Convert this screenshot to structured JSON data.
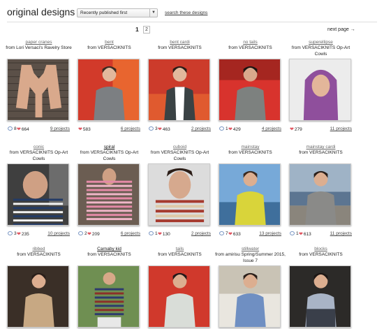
{
  "header": {
    "title": "original designs",
    "sort_value": "Recently published first",
    "search_link": "search these designs"
  },
  "pagination": {
    "current": "1",
    "next_number": "2",
    "next_label": "next page →"
  },
  "patterns": [
    {
      "name": "paper cranes",
      "from": "from Lori Versaci's Ravelry Store",
      "comments": "8",
      "favorites": "664",
      "projects": "9 projects",
      "scene": "cardigan-door"
    },
    {
      "name": "bent",
      "from": "from VERSACIKNITS",
      "comments": "",
      "favorites": "583",
      "projects": "6 projects",
      "scene": "grey-red"
    },
    {
      "name": "bent cardi",
      "from": "from VERSACIKNITS",
      "comments": "3",
      "favorites": "463",
      "projects": "2 projects",
      "scene": "cardi-red"
    },
    {
      "name": "no tails",
      "from": "from VERSACIKNITS",
      "comments": "1",
      "favorites": "429",
      "projects": "4 projects",
      "scene": "sweater-red"
    },
    {
      "name": "superellipse",
      "from": "from VERSACIKNITS Op-Art Cowls",
      "comments": "",
      "favorites": "279",
      "projects": "11 projects",
      "scene": "purple-hood"
    },
    {
      "name": "conic",
      "from": "from VERSACIKNITS Op-Art Cowls",
      "comments": "3",
      "favorites": "235",
      "projects": "10 projects",
      "scene": "navy-cowl"
    },
    {
      "name": "spiral",
      "from": "from VERSACIKNITS Op-Art Cowls",
      "comments": "2",
      "favorites": "209",
      "projects": "6 projects",
      "scene": "pink-cowl"
    },
    {
      "name": "cuboid",
      "from": "from VERSACIKNITS Op-Art Cowls",
      "comments": "1",
      "favorites": "130",
      "projects": "2 projects",
      "scene": "red-cowl"
    },
    {
      "name": "mainstay",
      "from": "from VERSACIKNITS",
      "comments": "7",
      "favorites": "633",
      "projects": "13 projects",
      "scene": "yellow-sea"
    },
    {
      "name": "mainstay cardi",
      "from": "from VERSACIKNITS",
      "comments": "1",
      "favorites": "613",
      "projects": "11 projects",
      "scene": "grey-beach"
    },
    {
      "name": "ribbed",
      "from": "from VERSACIKNITS",
      "scene": "tan-ribbed"
    },
    {
      "name": "Carnaby kid",
      "from": "from VERSACIKNITS",
      "scene": "striped-kid"
    },
    {
      "name": "tails",
      "from": "from VERSACIKNITS",
      "scene": "white-red"
    },
    {
      "name": "stillwater",
      "from": "from amirisu Spring/Summer 2015, Issue 7",
      "scene": "blue-house"
    },
    {
      "name": "blocks",
      "from": "from VERSACIKNITS",
      "scene": "blocks-dark"
    }
  ]
}
